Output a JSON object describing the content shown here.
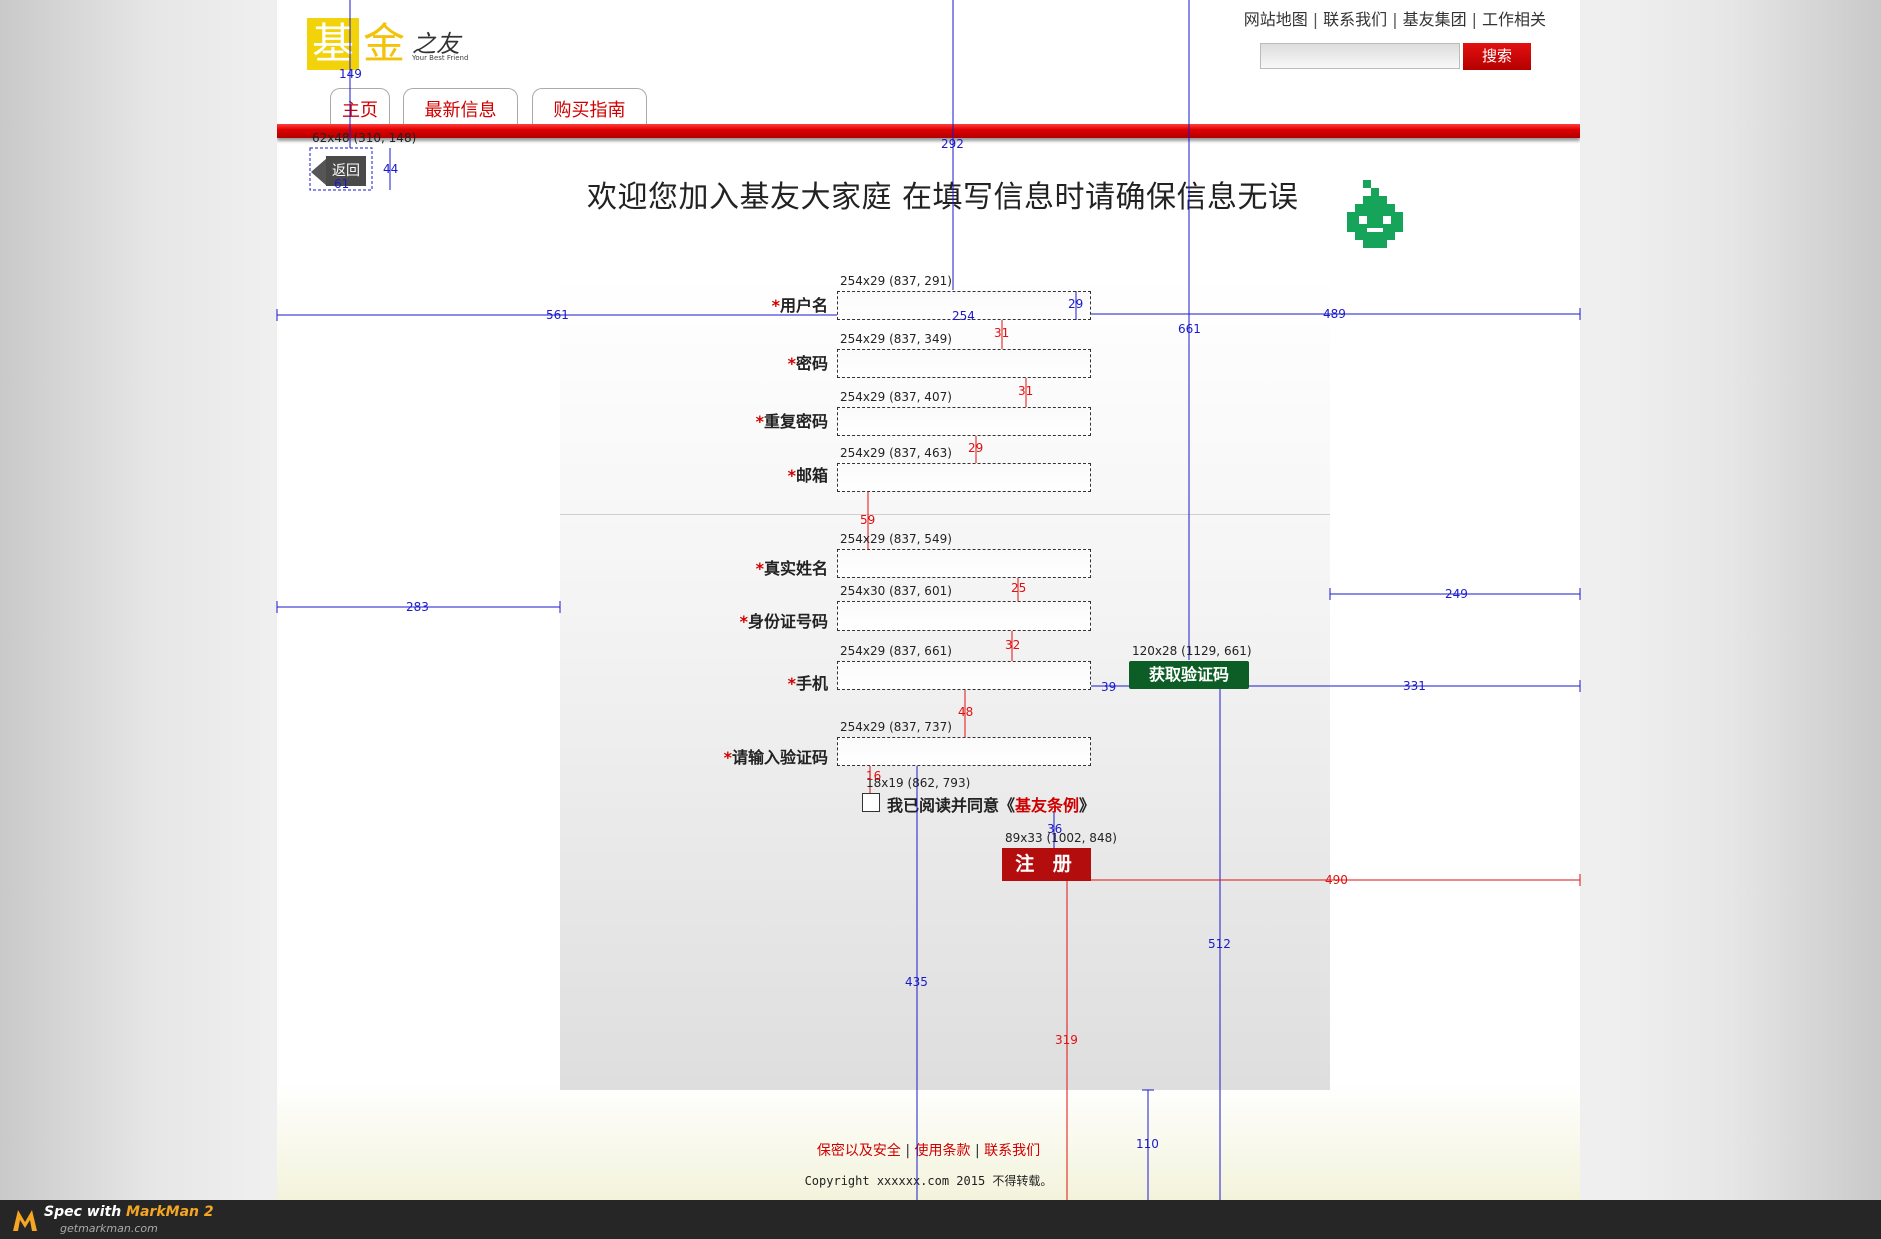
{
  "header": {
    "logo": {
      "char1": "基",
      "char2": "金",
      "char3": "之友",
      "tagline": "Your Best Friend"
    },
    "top_links": [
      "网站地图",
      "联系我们",
      "基友集团",
      "工作相关"
    ],
    "top_link_separator": "|",
    "search": {
      "placeholder": "",
      "button_label": "搜索"
    },
    "tabs": [
      {
        "label": "主页"
      },
      {
        "label": "最新信息"
      },
      {
        "label": "购买指南"
      }
    ]
  },
  "back_button": {
    "label": "返回"
  },
  "welcome_text": "欢迎您加入基友大家庭   在填写信息时请确保信息无误",
  "form": {
    "required_mark": "*",
    "fields": [
      {
        "label": "用户名",
        "value": ""
      },
      {
        "label": "密码",
        "value": ""
      },
      {
        "label": "重复密码",
        "value": ""
      },
      {
        "label": "邮箱",
        "value": ""
      },
      {
        "label": "真实姓名",
        "value": ""
      },
      {
        "label": "身份证号码",
        "value": ""
      },
      {
        "label": "手机",
        "value": ""
      },
      {
        "label": "请输入验证码",
        "value": ""
      }
    ],
    "get_code_button": "获取验证码",
    "agreement": {
      "prefix": "我已阅读并同意《",
      "link": "基友条例",
      "suffix": "》",
      "checked": false
    },
    "register_button": "注 册"
  },
  "footer": {
    "links": [
      "保密以及安全",
      "使用条款",
      "联系我们"
    ],
    "separator": "|",
    "copyright": "Copyright xxxxxx.com 2015 不得转载。"
  },
  "markman": {
    "title_prefix": "Spec with ",
    "title_app": "MarkMan 2",
    "site": "getmarkman.com"
  },
  "annotations": {
    "labels": [
      "149",
      "62x48 (310, 148)",
      "61",
      "44",
      "292",
      "661",
      "254x29 (837, 291)",
      "29",
      "254",
      "561",
      "489",
      "31",
      "254x29 (837, 349)",
      "31",
      "254x29 (837, 407)",
      "29",
      "254x29 (837, 463)",
      "59",
      "254x29 (837, 549)",
      "25",
      "254x30 (837, 601)",
      "283",
      "249",
      "32",
      "254x29 (837, 661)",
      "120x28 (1129, 661)",
      "39",
      "331",
      "48",
      "254x29 (837, 737)",
      "18x19 (862, 793)",
      "16",
      "36",
      "89x33 (1002, 848)",
      "490",
      "435",
      "512",
      "319",
      "110"
    ]
  },
  "colors": {
    "brand_red": "#d00000",
    "bar_red": "#e00000",
    "code_green": "#0d5e26",
    "register_red": "#b30d0d",
    "annotation_blue": "#1a1acc",
    "annotation_red": "#e01010"
  }
}
